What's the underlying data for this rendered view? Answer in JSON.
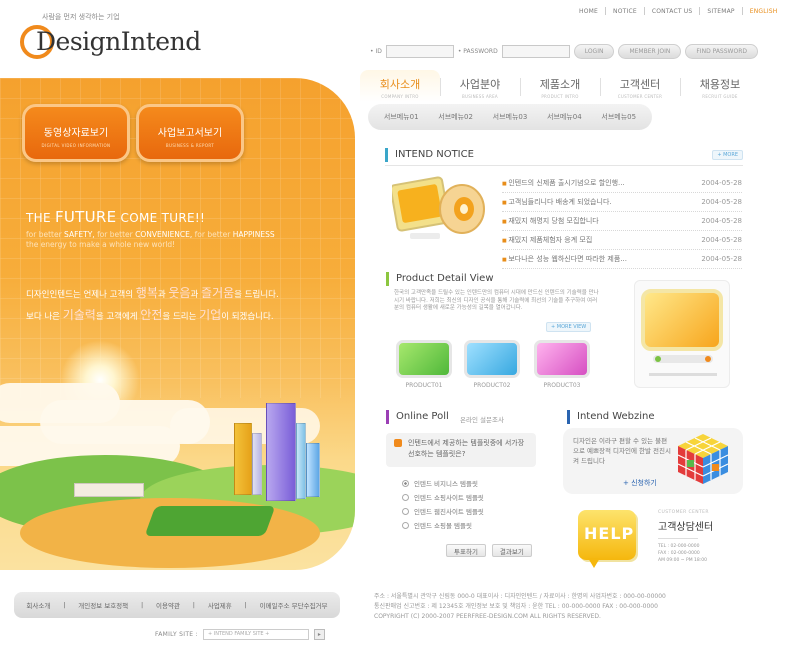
{
  "topnav": {
    "items": [
      "HOME",
      "NOTICE",
      "CONTACT US",
      "SITEMAP",
      "ENGLISH"
    ]
  },
  "logo": {
    "tagline": "사람을 먼저 생각하는 기업",
    "name": "DesignIntend"
  },
  "login": {
    "id_label": "• ID",
    "pw_label": "• PASSWORD",
    "login_button": "LOGIN",
    "member_join": "MEMBER JOIN",
    "find_password": "FIND PASSWORD"
  },
  "main_menu": [
    {
      "label": "회사소개",
      "sub": "COMPANY INTRO",
      "active": true
    },
    {
      "label": "사업분야",
      "sub": "BUSINESS AREA"
    },
    {
      "label": "제품소개",
      "sub": "PRODUCT INTRO"
    },
    {
      "label": "고객센터",
      "sub": "CUSTOMER CENTER"
    },
    {
      "label": "채용정보",
      "sub": "RECRUIT GUIDE"
    }
  ],
  "sub_menu": [
    "서브메뉴01",
    "서브메뉴02",
    "서브메뉴03",
    "서브메뉴04",
    "서브메뉴05"
  ],
  "hero": {
    "btn1": {
      "label": "동영상자료보기",
      "sub": "DIGITAL VIDEO INFORMATION"
    },
    "btn2": {
      "label": "사업보고서보기",
      "sub": "BUSINESS & REPORT"
    },
    "headline_pre": "THE",
    "headline_main": "FUTURE",
    "headline_post": "COME TURE!!",
    "en_line1_a": "for better",
    "en_line1_b": "SAFETY,",
    "en_line1_c": "for better",
    "en_line1_d": "CONVENIENCE,",
    "en_line1_e": "for better",
    "en_line1_f": "HAPPINESS",
    "en_line2": "the energy to make a whole new world!",
    "kr1_a": "디자인인텐드는 언제나 고객의",
    "kr1_b": "행복",
    "kr1_c": "과",
    "kr1_d": "웃음",
    "kr1_e": "과",
    "kr1_f": "즐거움",
    "kr1_g": "을 드립니다.",
    "kr2_a": "보다 나은",
    "kr2_b": "기술력",
    "kr2_c": "을 고객에게",
    "kr2_d": "안전",
    "kr2_e": "을 드리는",
    "kr2_f": "기업",
    "kr2_g": "이 되겠습니다."
  },
  "notice": {
    "title": "INTEND NOTICE",
    "more": "+ MORE",
    "items": [
      {
        "title": "인텐드의 신제품 출시기념으로 할인행...",
        "date": "2004-05-28"
      },
      {
        "title": "고객님들리니다 배송계 되었습니다.",
        "date": "2004-05-28"
      },
      {
        "title": "재밌지 해명지 당첨 모집합니다",
        "date": "2004-05-28"
      },
      {
        "title": "재밌지 제품체험자 응계 모집",
        "date": "2004-05-28"
      },
      {
        "title": "보다나은 성능 웹하신다면 따라한 제품...",
        "date": "2004-05-28"
      }
    ]
  },
  "product": {
    "title": "Product Detail View",
    "desc": "한국의 고객만족을 드릴수 있는 인텐드만의 컴퓨터 시대에 만드신 인텐드의 기술력을 만나시기 바랍니다. 저희는 최신의 디자인 공식을 통해 기술력에 최선의 기술을 추구하여 여러분의 컴퓨터 생활에 새로운 가능성의 길목을 열어갑니다.",
    "more": "+ MORE VIEW",
    "items": [
      "PRODUCT01",
      "PRODUCT02",
      "PRODUCT03"
    ]
  },
  "poll": {
    "title": "Online Poll",
    "subtitle": "온라인 설문조사",
    "question": "인텐드에서 제공하는 템플릿중에 서가장 선호하는 템플릿은?",
    "options": [
      "인텐드 비지니스 템플릿",
      "인텐드 쇼핑사이트 템플릿",
      "인텐드 웹진사이트 템플릿",
      "인텐드 쇼핑몰 템플릿"
    ],
    "vote": "투표하기",
    "results": "결과보기"
  },
  "webzine": {
    "title": "Intend Webzine",
    "text": "디자인은 이라구 편할 수 있는 불편으로 예쁘장적 디자인에 한발 전진시켜 드립니다",
    "link": "+ 신청하기"
  },
  "customer": {
    "sub": "CUSTOMER CENTER",
    "title": "고객상담센터",
    "tel": "TEL : 02-000-0000",
    "fax": "FAX : 02-000-0000",
    "email": "AM 09:00 ~ PM 18:00",
    "help": "HELP"
  },
  "footer": {
    "links": [
      "회사소개",
      "개인정보 보호정책",
      "이용약관",
      "사업제휴",
      "이메일주소 무단수집거부"
    ],
    "family_label": "FAMILY SITE :",
    "family_select": "+ INTEND FAMILY SITE +",
    "info1": "주소 : 서울특별시 관악구 신림동 000-0  대표이사 : 디자인인텐드  /  자료이사 : 한명의 사업자번호 : 000-00-00000",
    "info2": "통신판매업 신고번호 : 제 12345호  개인정보 보호 및 책임자 : 윤한 TEL : 00-000-0000  FAX : 00-000-0000",
    "copyright": "COPYRIGHT (C) 2000-2007 PEERFREE-DESIGN.COM ALL RIGHTS RESERVED."
  },
  "colors": {
    "accent": "#e88d1a",
    "notice_bar": "#3aa6c9",
    "product_bar": "#8cc63f",
    "poll_bar": "#9b3fb5",
    "webzine_bar": "#2a64b0"
  }
}
